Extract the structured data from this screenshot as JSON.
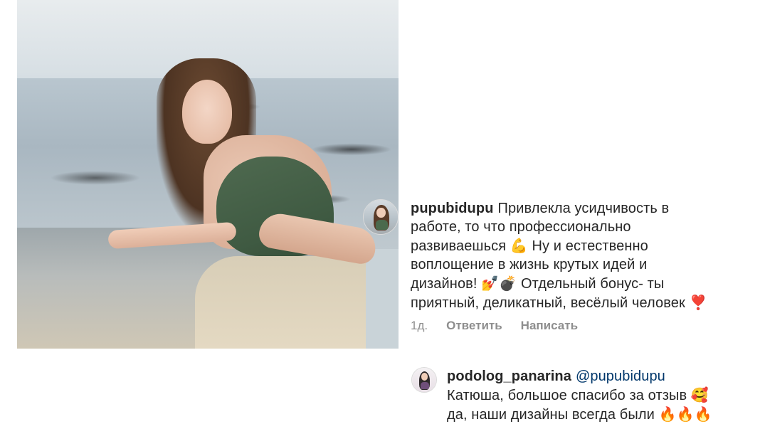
{
  "post": {
    "photo_alt": "photo-woman-on-rock"
  },
  "comment1": {
    "username": "pupubidupu",
    "text_line1": "Привлекла усидчивость в",
    "text_line2": "работе, то что профессионально",
    "text_line3a": "развиваешься",
    "emoji_muscle": "💪",
    "text_line3b": "Ну и естественно",
    "text_line4": "воплощение в жизнь крутых идей и",
    "text_line5a": "дизайнов!",
    "emoji_nail": "💅",
    "emoji_bomb": "💣",
    "text_line5b": "Отдельный бонус- ты",
    "text_line6": "приятный, деликатный, весёлый человек",
    "emoji_heart": "❣️",
    "time": "1д.",
    "reply_label": "Ответить",
    "message_label": "Написать"
  },
  "comment2": {
    "username": "podolog_panarina",
    "mention": "@pupubidupu",
    "text_line1": "Катюша, большое спасибо за отзыв",
    "emoji_smile": "🥰",
    "text_line2": "да, наши дизайны всегда были",
    "emoji_fire": "🔥🔥🔥"
  }
}
